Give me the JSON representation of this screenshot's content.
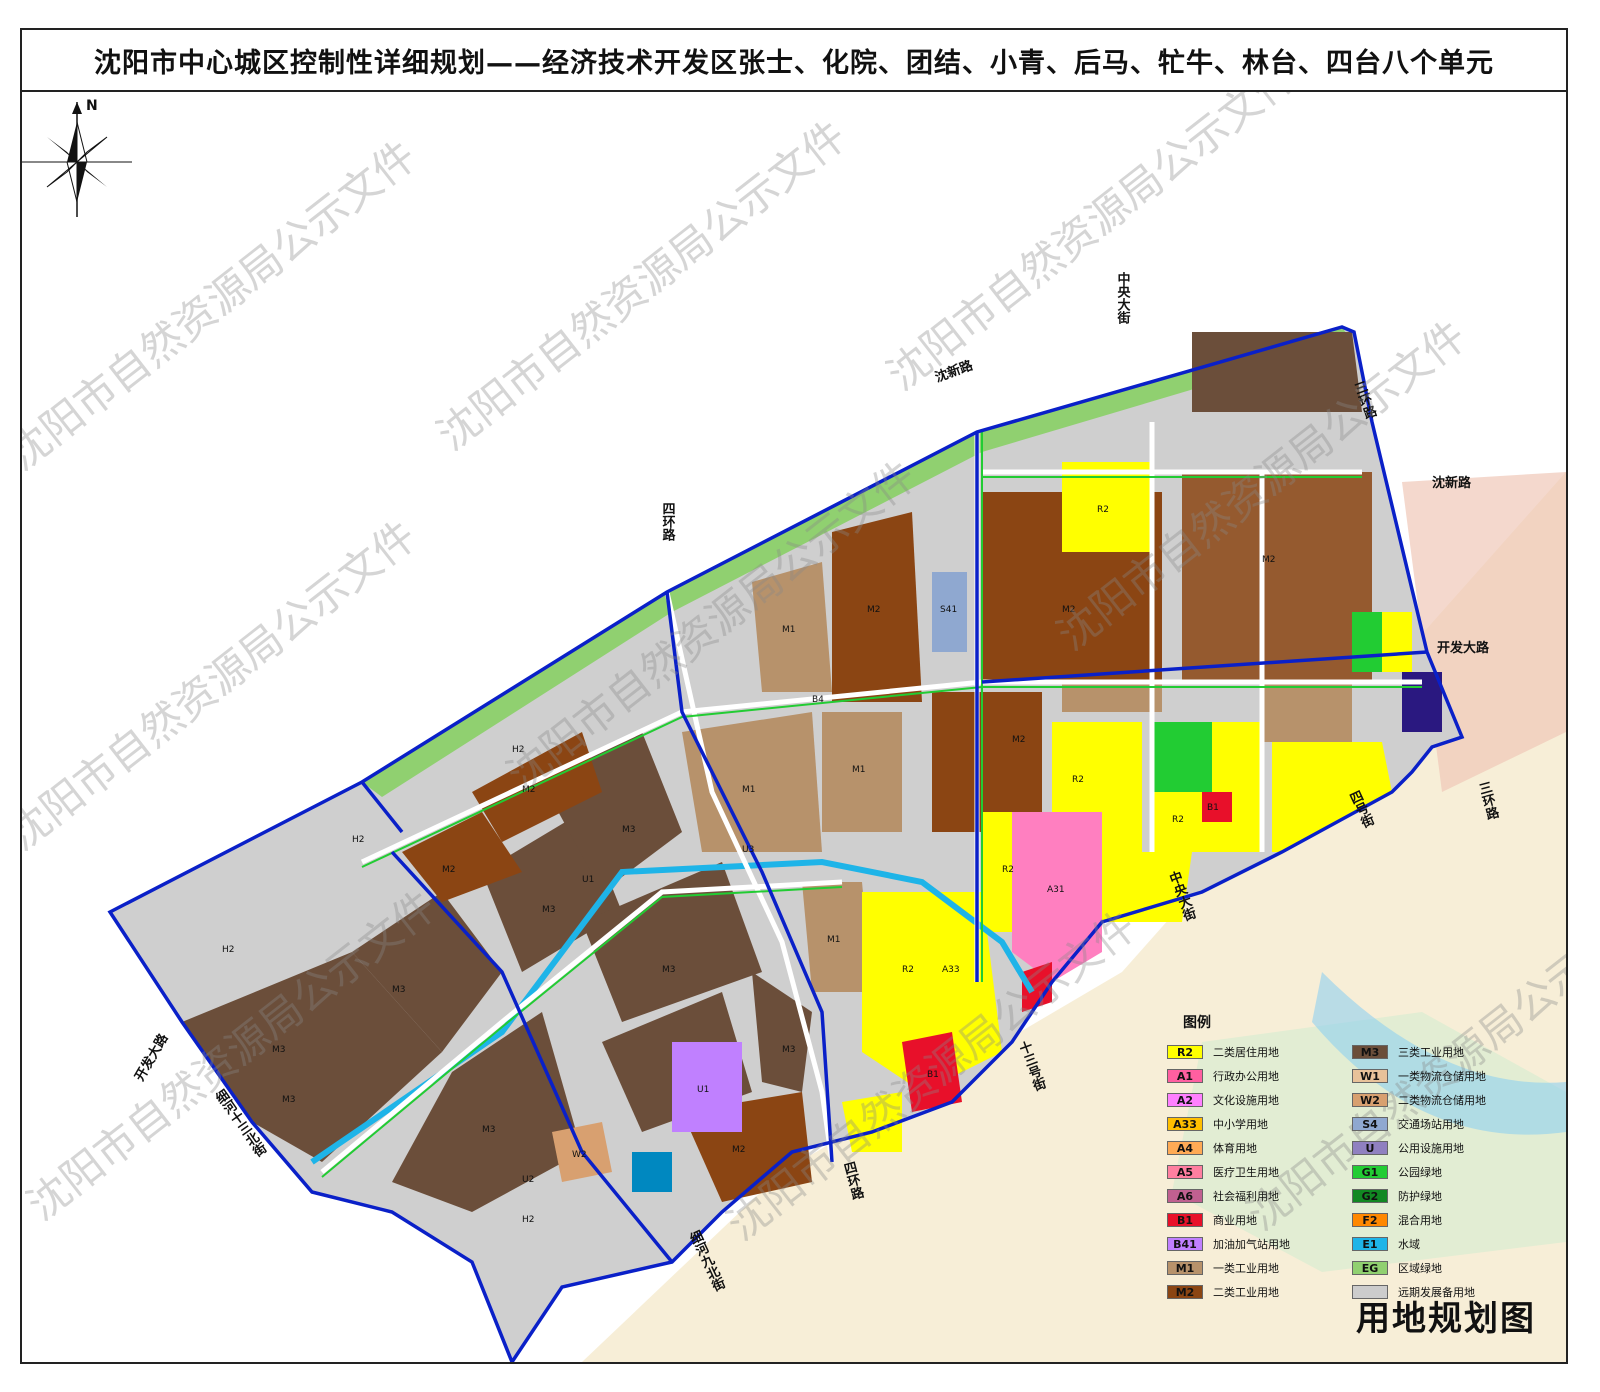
{
  "title": "沈阳市中心城区控制性详细规划——经济技术开发区张士、化院、团结、小青、后马、牤牛、林台、四台八个单元",
  "map_title": "用地规划图",
  "north_label": "N",
  "watermark": "沈阳市自然资源局公示文件",
  "roads": {
    "shenxin_1": "沈新路",
    "shenxin_2": "沈新路",
    "zhongyang_1": "中央大街",
    "zhongyang_2": "中央大街",
    "sihuan_1": "四环路",
    "sihuan_2": "四环路",
    "sanhuan_1": "三环路",
    "sanhuan_2": "三环路",
    "kaifa_1": "开发大路",
    "kaifa_2": "开发大路",
    "sihao": "四号街",
    "shisanhao": "十三号街",
    "xihe13": "细河十三北街",
    "xihe9": "细河九北街"
  },
  "legend": {
    "title": "图例",
    "items": [
      {
        "code": "R2",
        "name": "二类居住用地",
        "color": "#ffff00"
      },
      {
        "code": "A1",
        "name": "行政办公用地",
        "color": "#ff5fa0"
      },
      {
        "code": "A2",
        "name": "文化设施用地",
        "color": "#ff80ff"
      },
      {
        "code": "A33",
        "name": "中小学用地",
        "color": "#ffbf00"
      },
      {
        "code": "A4",
        "name": "体育用地",
        "color": "#ffaa55"
      },
      {
        "code": "A5",
        "name": "医疗卫生用地",
        "color": "#ff7fa0"
      },
      {
        "code": "A6",
        "name": "社会福利用地",
        "color": "#c06090"
      },
      {
        "code": "B1",
        "name": "商业用地",
        "color": "#e8102a"
      },
      {
        "code": "B41",
        "name": "加油加气站用地",
        "color": "#c080ff"
      },
      {
        "code": "M1",
        "name": "一类工业用地",
        "color": "#b7926b"
      },
      {
        "code": "M2",
        "name": "二类工业用地",
        "color": "#8b4513"
      },
      {
        "code": "M3",
        "name": "三类工业用地",
        "color": "#6b4e3a"
      },
      {
        "code": "W1",
        "name": "一类物流仓储用地",
        "color": "#e8c29a"
      },
      {
        "code": "W2",
        "name": "二类物流仓储用地",
        "color": "#d8a070"
      },
      {
        "code": "S4",
        "name": "交通场站用地",
        "color": "#8fa8d0"
      },
      {
        "code": "U",
        "name": "公用设施用地",
        "color": "#9080c0"
      },
      {
        "code": "G1",
        "name": "公园绿地",
        "color": "#22cc33"
      },
      {
        "code": "G2",
        "name": "防护绿地",
        "color": "#118822"
      },
      {
        "code": "F2",
        "name": "混合用地",
        "color": "#ff8800"
      },
      {
        "code": "E1",
        "name": "水域",
        "color": "#1eb4e8"
      },
      {
        "code": "EG",
        "name": "区域绿地",
        "color": "#90d070"
      },
      {
        "code": "",
        "name": "远期发展备用地",
        "color": "#cccccc"
      }
    ]
  },
  "parcel_labels": {
    "m3_a": "M3",
    "m3_b": "M3",
    "m3_c": "M3",
    "m3_d": "M3",
    "m3_e": "M3",
    "m3_f": "M3",
    "m3_g": "M3",
    "m3_h": "M3",
    "m2_a": "M2",
    "m2_b": "M2",
    "m2_c": "M2",
    "m2_d": "M2",
    "m2_e": "M2",
    "m2_f": "M2",
    "m2_g": "M2",
    "m1_a": "M1",
    "m1_b": "M1",
    "m1_c": "M1",
    "m1_d": "M1",
    "r2_a": "R2",
    "r2_b": "R2",
    "r2_c": "R2",
    "r2_d": "R2",
    "r2_e": "R2",
    "a31": "A31",
    "s41": "S41",
    "u1_a": "U1",
    "u1_b": "U1",
    "h2_a": "H2",
    "h2_b": "H2",
    "h2_c": "H2",
    "h2_d": "H2",
    "b1_a": "B1",
    "b1_b": "B1",
    "w2": "W2",
    "a33": "A33",
    "u2": "U2",
    "u3": "U3",
    "b4": "B4"
  }
}
